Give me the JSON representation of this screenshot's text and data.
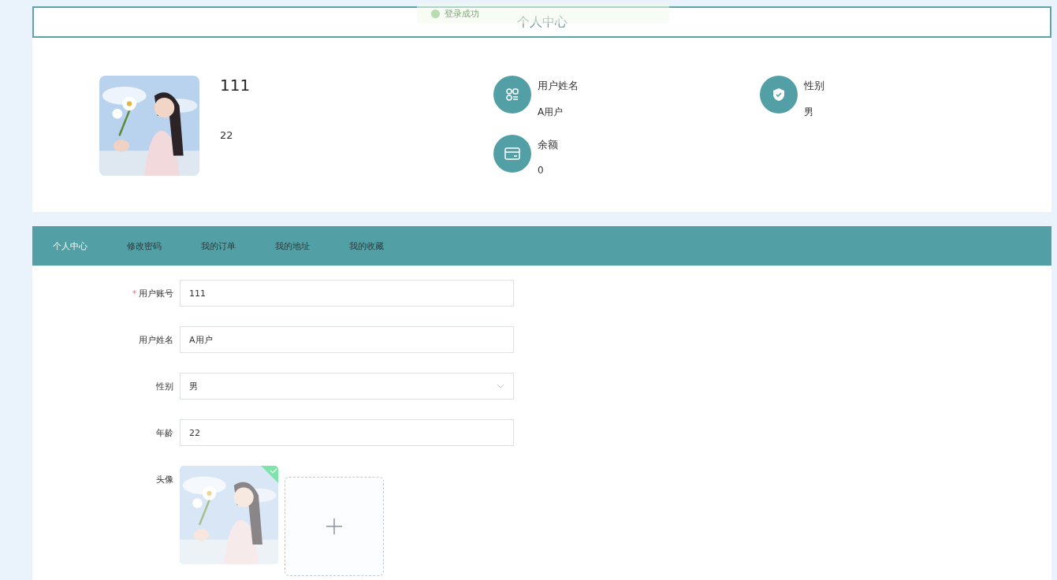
{
  "toast": {
    "text": "登录成功"
  },
  "title": "个人中心",
  "profile": {
    "account": "111",
    "age": "22",
    "stats": [
      {
        "kind": "name",
        "label": "用户姓名",
        "value": "A用户"
      },
      {
        "kind": "gender",
        "label": "性别",
        "value": "男"
      },
      {
        "kind": "balance",
        "label": "余额",
        "value": "0"
      }
    ]
  },
  "tabs": [
    {
      "label": "个人中心",
      "selected": true
    },
    {
      "label": "修改密码",
      "selected": false
    },
    {
      "label": "我的订单",
      "selected": false
    },
    {
      "label": "我的地址",
      "selected": false
    },
    {
      "label": "我的收藏",
      "selected": false
    }
  ],
  "form": [
    {
      "kind": "input",
      "label": "用户账号",
      "marker": "*",
      "value": "111"
    },
    {
      "kind": "input",
      "label": "用户姓名",
      "value": "A用户"
    },
    {
      "kind": "select",
      "label": "性别",
      "value": "男"
    },
    {
      "kind": "input",
      "label": "年龄",
      "value": "22"
    },
    {
      "kind": "upload",
      "label": "头像",
      "uploaded": true
    }
  ]
}
